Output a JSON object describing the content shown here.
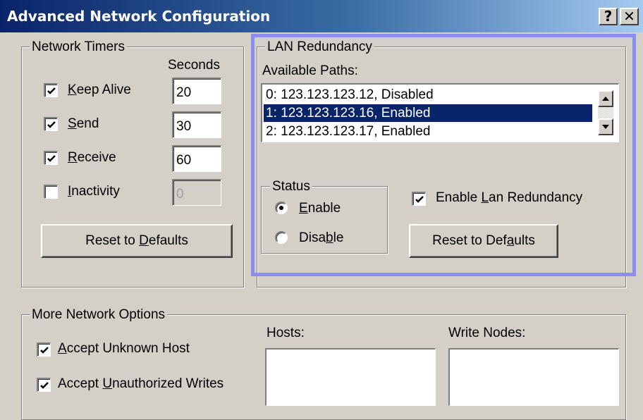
{
  "window": {
    "title": "Advanced Network Configuration",
    "help_label": "?",
    "close_label": "✕"
  },
  "timers": {
    "legend": "Network Timers",
    "seconds_header": "Seconds",
    "rows": [
      {
        "pre": "",
        "key": "K",
        "post": "eep Alive",
        "checked": true,
        "value": "20"
      },
      {
        "pre": "",
        "key": "S",
        "post": "end",
        "checked": true,
        "value": "30"
      },
      {
        "pre": "",
        "key": "R",
        "post": "eceive",
        "checked": true,
        "value": "60"
      },
      {
        "pre": "",
        "key": "I",
        "post": "nactivity",
        "checked": false,
        "value": "0"
      }
    ],
    "reset": {
      "pre": "Reset to ",
      "key": "D",
      "post": "efaults"
    }
  },
  "lan": {
    "legend": "LAN Redundancy",
    "paths_label": "Available Paths:",
    "paths": [
      "0: 123.123.123.12, Disabled",
      "1: 123.123.123.16, Enabled",
      "2: 123.123.123.17, Enabled"
    ],
    "selected_index": 1,
    "status": {
      "legend": "Status",
      "enable": {
        "pre": "",
        "key": "E",
        "post": "nable"
      },
      "disable": {
        "pre": "Disa",
        "key": "b",
        "post": "le"
      },
      "selected": "enable"
    },
    "enable_redundancy": {
      "pre": "Enable ",
      "key": "L",
      "post": "an Redundancy",
      "checked": true
    },
    "reset": {
      "pre": "Reset to Def",
      "key": "a",
      "post": "ults"
    }
  },
  "more": {
    "legend": "More Network Options",
    "accept_unknown": {
      "pre": "",
      "key": "A",
      "post": "ccept Unknown Host",
      "checked": true
    },
    "accept_unauth": {
      "pre": "Accept ",
      "key": "U",
      "post": "nauthorized Writes",
      "checked": true
    },
    "hosts_label": "Hosts:",
    "write_nodes_label": "Write Nodes:"
  },
  "colors": {
    "titlebar_start": "#0a246a",
    "titlebar_end": "#a6caf0",
    "selection": "#0a246a",
    "focus_frame": "#8b8ef0",
    "face": "#d4d0c8"
  }
}
